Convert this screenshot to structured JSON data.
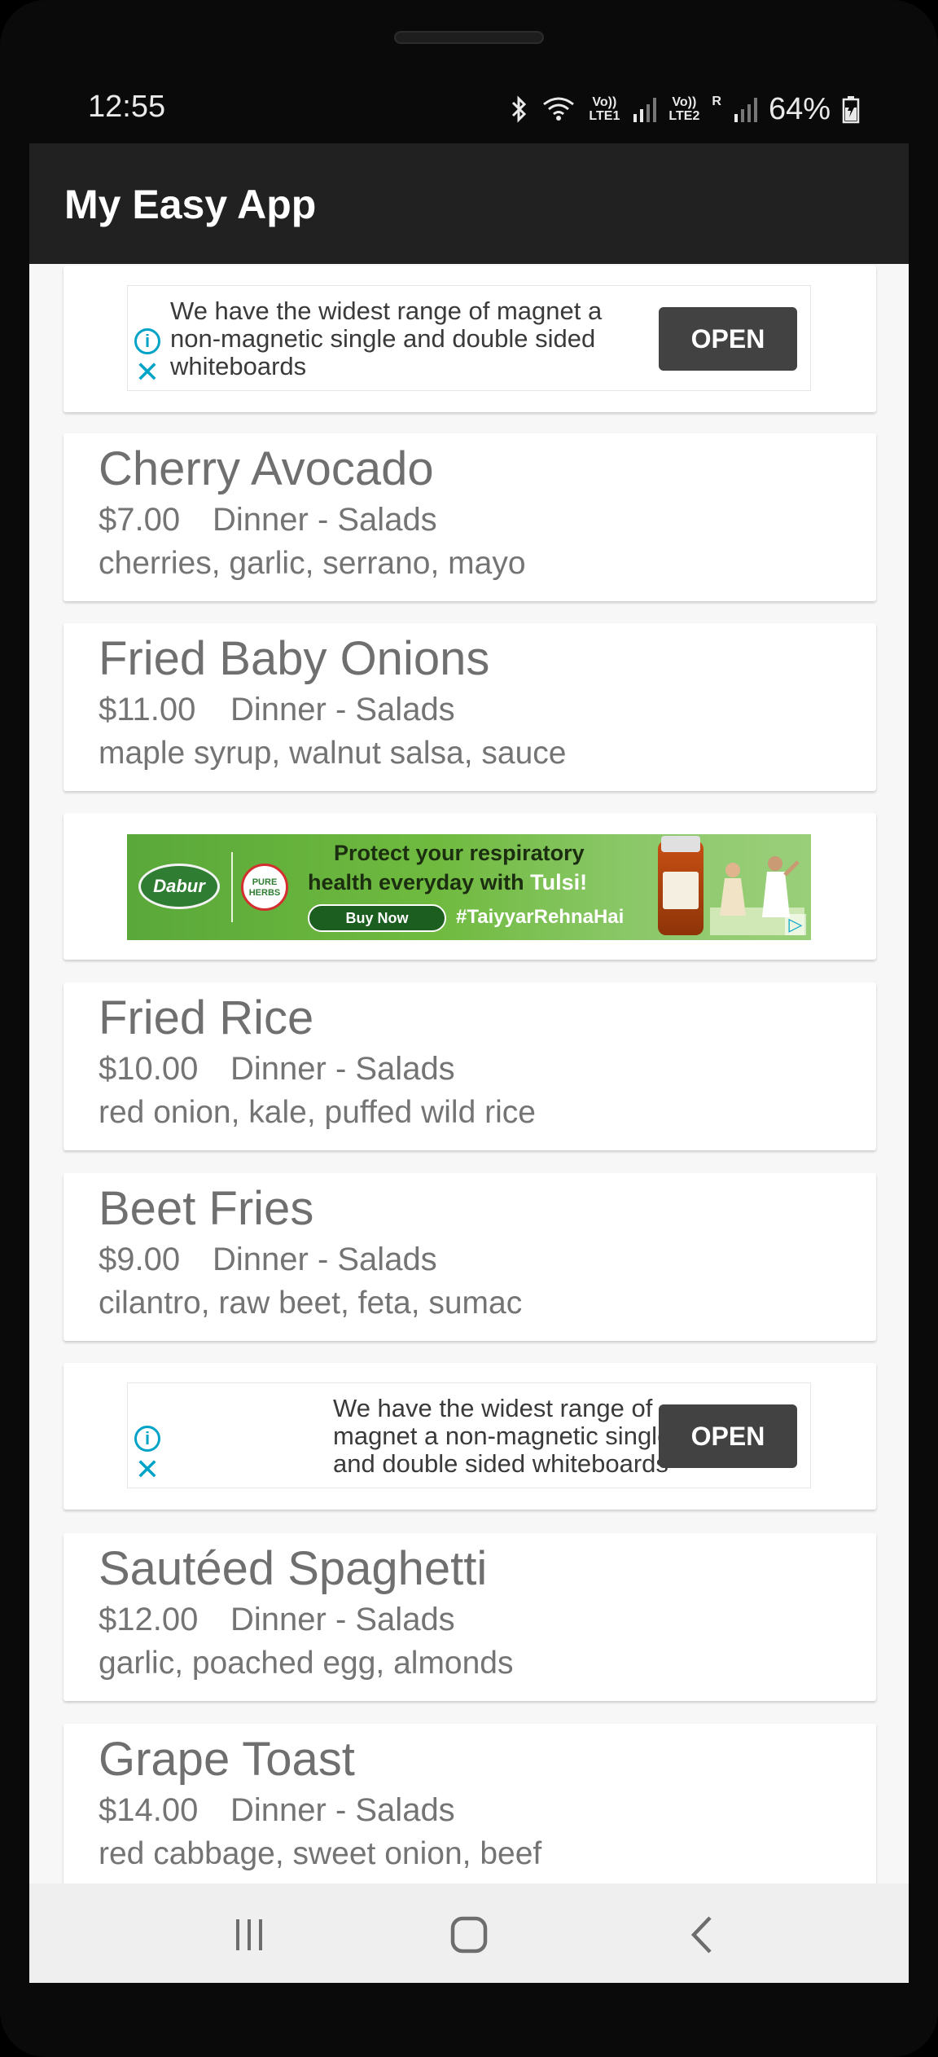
{
  "status_bar": {
    "time": "12:55",
    "signal_label_1": "Vo)) LTE1",
    "signal_label_2": "Vo)) LTE2",
    "roaming": "R",
    "battery": "64%"
  },
  "app_bar": {
    "title": "My Easy App"
  },
  "ads": {
    "text_ad_1": {
      "text": "We have the widest range of magnet a non-magnetic single and double sided whiteboards",
      "button": "OPEN"
    },
    "banner": {
      "brand": "Dabur",
      "badge": "PURE HERBS",
      "line1": "Protect your respiratory",
      "line2_prefix": "health everyday with ",
      "line2_highlight": "Tulsi!",
      "cta": "Buy Now",
      "hashtag": "#TaiyyarRehnaHai"
    },
    "text_ad_2": {
      "text": "We have the widest range of magnet a non-magnetic single and double sided whiteboards",
      "button": "OPEN"
    }
  },
  "menu_items": [
    {
      "name": "Cherry Avocado",
      "price": "$7.00",
      "category": "Dinner - Salads",
      "ingredients": "cherries, garlic, serrano, mayo"
    },
    {
      "name": "Fried Baby Onions",
      "price": "$11.00",
      "category": "Dinner - Salads",
      "ingredients": "maple syrup, walnut salsa, sauce"
    },
    {
      "name": "Fried Rice",
      "price": "$10.00",
      "category": "Dinner - Salads",
      "ingredients": "red onion, kale, puffed wild rice"
    },
    {
      "name": "Beet Fries",
      "price": "$9.00",
      "category": "Dinner - Salads",
      "ingredients": "cilantro, raw beet, feta, sumac"
    },
    {
      "name": "Sautéed Spaghetti",
      "price": "$12.00",
      "category": "Dinner - Salads",
      "ingredients": "garlic, poached egg, almonds"
    },
    {
      "name": "Grape Toast",
      "price": "$14.00",
      "category": "Dinner - Salads",
      "ingredients": "red cabbage, sweet onion, beef"
    }
  ],
  "nav_bar": {
    "recents": "recents-icon",
    "home": "home-icon",
    "back": "back-icon"
  }
}
